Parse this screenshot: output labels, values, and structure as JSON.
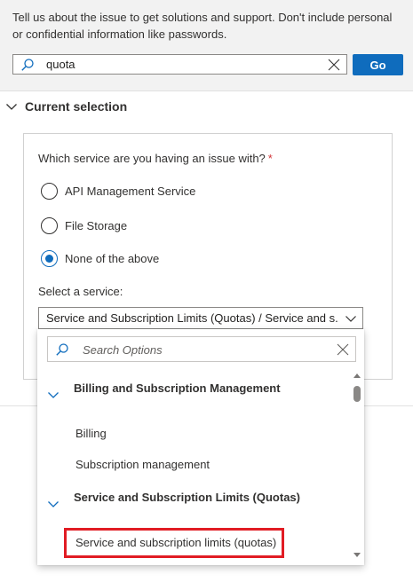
{
  "header": {
    "description": "Tell us about the issue to get solutions and support. Don't include personal or confidential information like passwords.",
    "search_value": "quota",
    "go_label": "Go"
  },
  "current_selection": {
    "label": "Current selection"
  },
  "form": {
    "question": "Which service are you having an issue with?",
    "required_mark": "*",
    "radio_options": [
      {
        "label": "API Management Service",
        "selected": false
      },
      {
        "label": "File Storage",
        "selected": false
      },
      {
        "label": "None of the above",
        "selected": true
      }
    ],
    "select_service_label": "Select a service:",
    "select_service_value": "Service and Subscription Limits (Quotas) / Service and s..."
  },
  "dropdown_popup": {
    "search_placeholder": "Search Options",
    "groups": [
      {
        "label": "Billing and Subscription Management",
        "items": [
          "Billing",
          "Subscription management"
        ]
      },
      {
        "label": "Service and Subscription Limits (Quotas)",
        "items": [
          "Service and subscription limits (quotas)"
        ]
      }
    ],
    "highlighted_item": "Service and subscription limits (quotas)"
  },
  "colors": {
    "accent": "#0f6cbd",
    "highlight_border": "#e11c24",
    "required": "#d13438"
  }
}
